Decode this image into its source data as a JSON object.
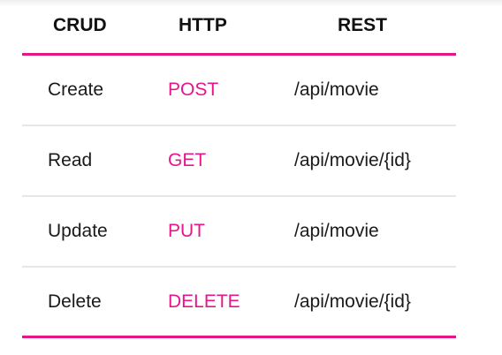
{
  "header": {
    "crud": "CRUD",
    "http": "HTTP",
    "rest": "REST"
  },
  "rows": [
    {
      "crud": "Create",
      "http": "POST",
      "rest": "/api/movie"
    },
    {
      "crud": "Read",
      "http": "GET",
      "rest": "/api/movie/{id}"
    },
    {
      "crud": "Update",
      "http": "PUT",
      "rest": "/api/movie"
    },
    {
      "crud": "Delete",
      "http": "DELETE",
      "rest": "/api/movie/{id}"
    }
  ],
  "colors": {
    "accent": "#e6168a",
    "divider": "#e6e6e6",
    "text": "#1a1a1a"
  }
}
